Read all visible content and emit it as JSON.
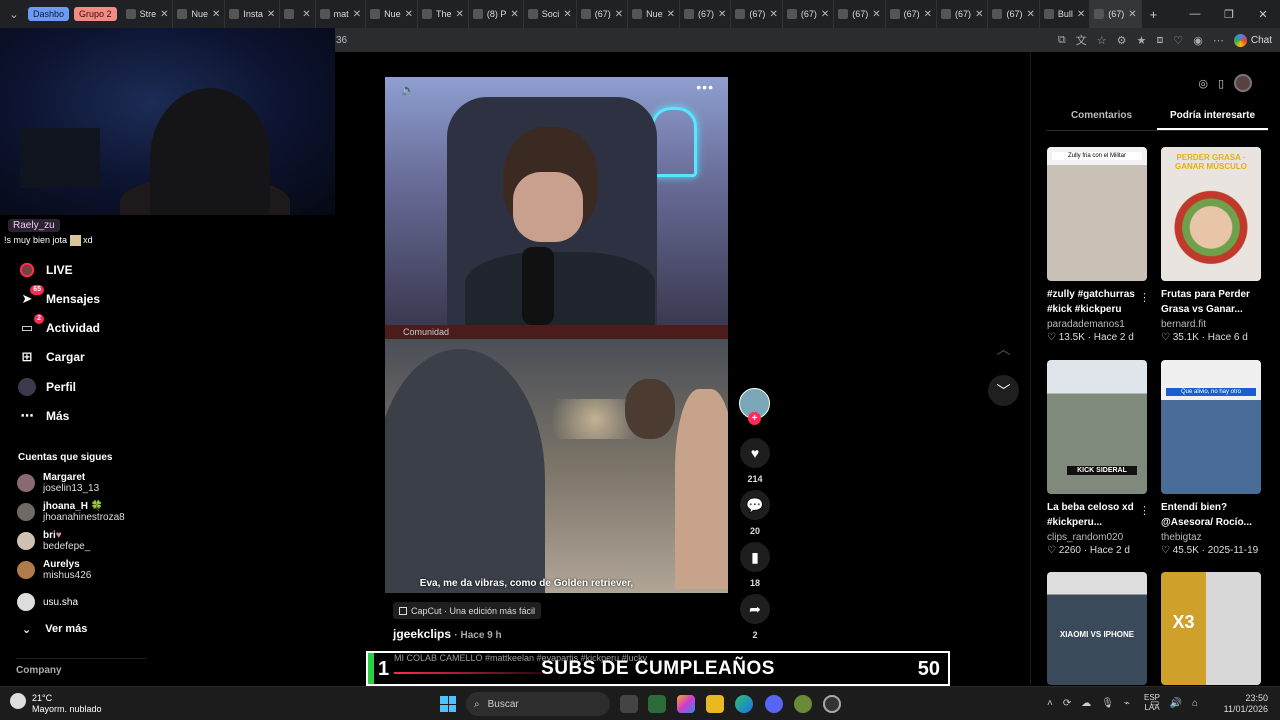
{
  "browser": {
    "groups": [
      {
        "label": "Dashbo",
        "color": "#6b9bf5"
      },
      {
        "label": "Grupo 2",
        "color": "#f28b82"
      }
    ],
    "tabs": [
      {
        "label": "Stre"
      },
      {
        "label": "Nue"
      },
      {
        "label": "Insta"
      },
      {
        "label": ""
      },
      {
        "label": "mat"
      },
      {
        "label": "Nue"
      },
      {
        "label": "The"
      },
      {
        "label": "(8) P"
      },
      {
        "label": "Soci"
      },
      {
        "label": "(67)"
      },
      {
        "label": "Nue"
      },
      {
        "label": "(67)"
      },
      {
        "label": "(67)"
      },
      {
        "label": "(67)"
      },
      {
        "label": "(67)"
      },
      {
        "label": "(67)"
      },
      {
        "label": "(67)"
      },
      {
        "label": "(67)"
      },
      {
        "label": "Bull"
      },
      {
        "label": "(67)"
      }
    ],
    "url_fragment": "36",
    "chat_label": "Chat"
  },
  "stream_chat": {
    "username": "Raely_zu",
    "message": "!s muy bien jota",
    "message_tail": "xd"
  },
  "sidebar": {
    "nav": [
      {
        "label": "LIVE",
        "badge": ""
      },
      {
        "label": "Mensajes",
        "badge": "65"
      },
      {
        "label": "Actividad",
        "badge": "2"
      },
      {
        "label": "Cargar",
        "badge": ""
      },
      {
        "label": "Perfil",
        "badge": ""
      },
      {
        "label": "Más",
        "badge": ""
      }
    ],
    "following_title": "Cuentas que sigues",
    "following": [
      {
        "name": "Margaret",
        "handle": "joselin13_13"
      },
      {
        "name": "jhoana_H",
        "handle": "jhoanahinestroza8"
      },
      {
        "name": "bri",
        "handle": "bedefepe_"
      },
      {
        "name": "Aurelys",
        "handle": "mishus426"
      },
      {
        "name": "usu.sha",
        "handle": ""
      }
    ],
    "see_more": "Ver más",
    "company": "Company"
  },
  "feed": {
    "top_strip": "Comunidad",
    "caption_subtitle": "Eva, me da vibras, como de Golden retriever,",
    "capcut": "CapCut · Una edición más fácil",
    "author": "jgeekclips",
    "time_ago": "· Hace 9 h",
    "actions": {
      "likes": "214",
      "comments": "20",
      "saves": "18",
      "shares": "2"
    }
  },
  "sub_goal": {
    "current": "1",
    "label": "SUBS DE CUMPLEAÑOS",
    "target": "50",
    "ticker": "MI COLAB CAMELLO #mattkeelan #evapartis #kickperu #lucky"
  },
  "right_panel": {
    "tabs": [
      "Comentarios",
      "Podría interesarte"
    ],
    "active_tab": 1,
    "cards": [
      {
        "caption": "#zully #gatchurras #kick #kickperu",
        "author": "paradademanos1",
        "likes": "13.5K",
        "date": "Hace 2 d",
        "thumb_text": "Zully fria con el Militar",
        "thumb_color": "#c9c0b6"
      },
      {
        "caption": "Frutas para Perder Grasa vs Ganar...",
        "author": "bernard.fit",
        "likes": "35.1K",
        "date": "Hace 6 d",
        "thumb_text": "PERDER GRASA · GANAR MÚSCULO",
        "thumb_color": "#b89a7e"
      },
      {
        "caption": "La beba celoso xd #kickperu...",
        "author": "clips_random020",
        "likes": "2260",
        "date": "Hace 2 d",
        "thumb_text": "KICK SIDERAL",
        "thumb_color": "#7f8a7c"
      },
      {
        "caption": "Entendí bien? @Asesora/ Rocío...",
        "author": "thebigtaz",
        "likes": "45.5K",
        "date": "2025-11-19",
        "thumb_text": "Que alivio, no hay otro",
        "thumb_color": "#4a6d98"
      },
      {
        "caption": "",
        "author": "",
        "likes": "",
        "date": "",
        "thumb_text": "XIAOMI VS IPHONE",
        "thumb_color": "#3a4a5a"
      },
      {
        "caption": "",
        "author": "",
        "likes": "",
        "date": "",
        "thumb_text": "X3",
        "thumb_color": "#cfa02a"
      }
    ]
  },
  "taskbar": {
    "temp": "21°C",
    "weather": "Mayorm. nublado",
    "search": "Buscar",
    "lang_1": "ESP",
    "lang_2": "LAA",
    "time": "23:50",
    "date": "11/01/2026"
  },
  "colors": {
    "accent": "#fe2c55",
    "goal_bar": "#27d045"
  }
}
